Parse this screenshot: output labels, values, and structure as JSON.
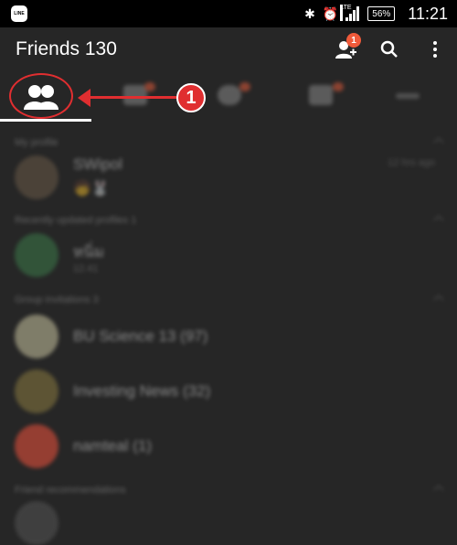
{
  "status_bar": {
    "line_logo": "LINE",
    "lte": "LTE",
    "battery": "56%",
    "time": "11:21"
  },
  "app_bar": {
    "title": "Friends 130",
    "add_friend_badge": "1"
  },
  "annotation": {
    "number": "1"
  },
  "list": {
    "sections": [
      "My profile",
      "Recently updated profiles 1",
      "Group invitations 3",
      "Friend recommendations"
    ],
    "profile": {
      "name": "SWipol",
      "meta": "12 hrs ago"
    },
    "recent": {
      "name": "หนิ่ม",
      "sub": "12.41"
    },
    "groups": [
      {
        "name": "BU Science 13 (97)"
      },
      {
        "name": "Investing News (32)"
      },
      {
        "name": "namteal (1)"
      }
    ]
  },
  "colors": {
    "background": "#262626",
    "status_bar": "#000000",
    "accent_red": "#e02e30",
    "badge_orange": "#f05a3a"
  }
}
